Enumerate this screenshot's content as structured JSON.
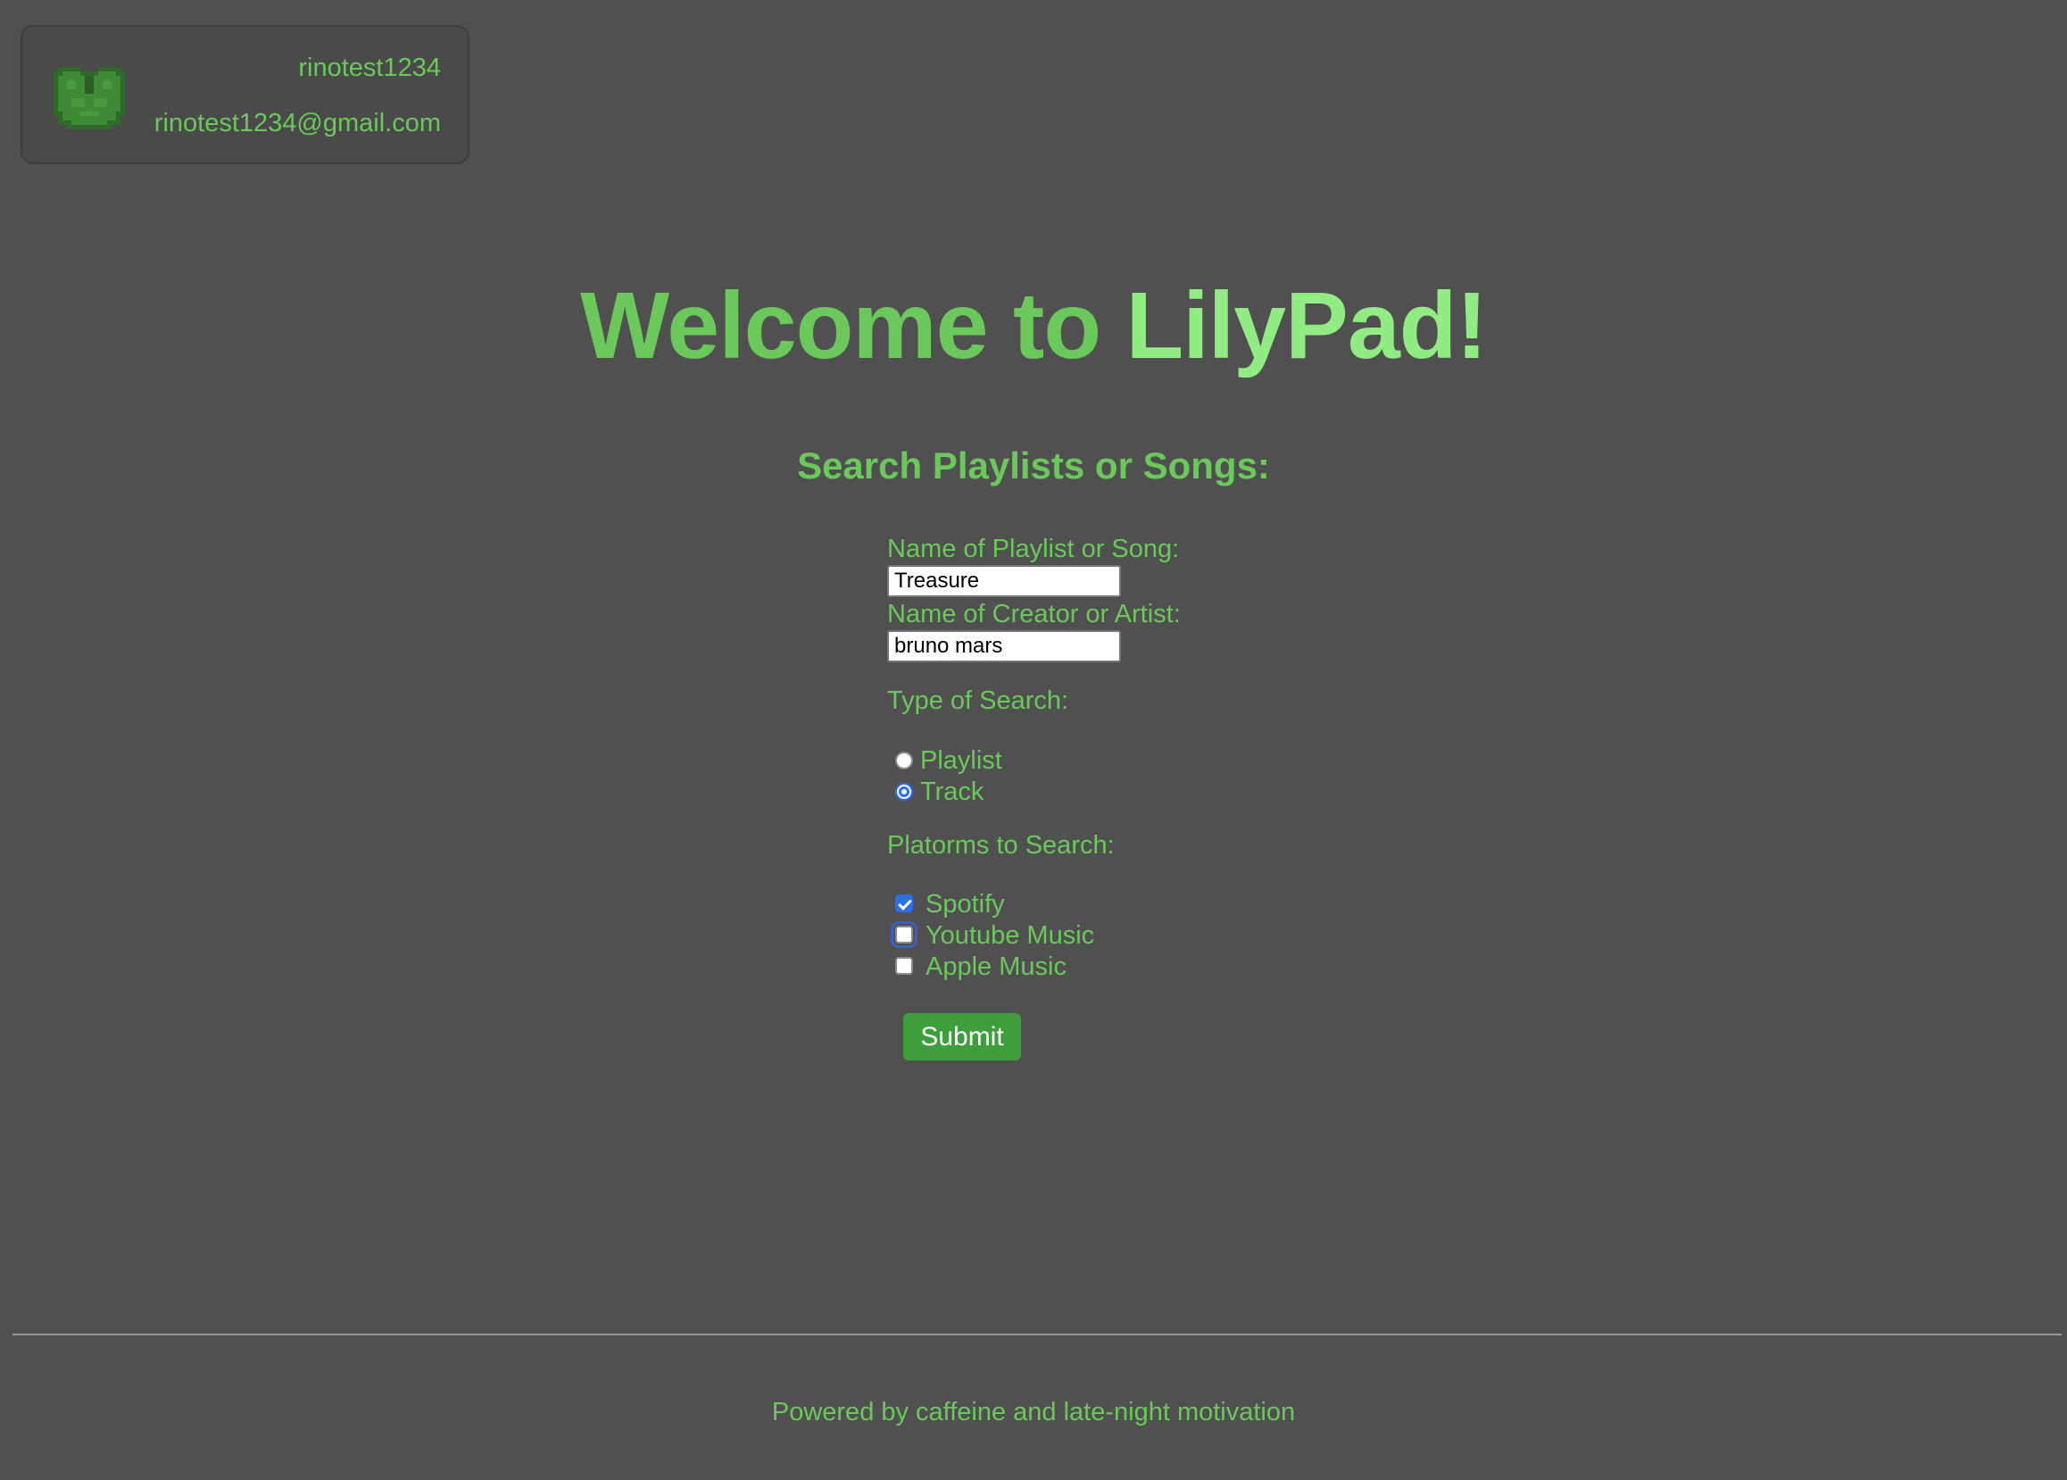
{
  "user": {
    "username": "rinotest1234",
    "email": "rinotest1234@gmail.com",
    "avatar_icon": "lily-pad-icon"
  },
  "header": {
    "title_part1": "Welcome to",
    "title_part2": "LilyPad!"
  },
  "search": {
    "heading": "Search Playlists or Songs:",
    "name_label": "Name of Playlist or Song:",
    "name_value": "Treasure",
    "creator_label": "Name of Creator or Artist:",
    "creator_value": "bruno mars",
    "type_label": "Type of Search:",
    "types": [
      {
        "label": "Playlist",
        "selected": false
      },
      {
        "label": "Track",
        "selected": true
      }
    ],
    "platforms_label": "Platorms to Search:",
    "platforms": [
      {
        "label": "Spotify",
        "checked": true
      },
      {
        "label": "Youtube Music",
        "checked": false
      },
      {
        "label": "Apple Music",
        "checked": false
      }
    ],
    "submit_label": "Submit"
  },
  "footer": {
    "text": "Powered by caffeine and late-night motivation"
  },
  "colors": {
    "background": "#505050",
    "accent_green": "#6ac95a",
    "light_green": "#92ec84",
    "button_green": "#3d9e3b",
    "selection_blue": "#2a6ff2"
  }
}
